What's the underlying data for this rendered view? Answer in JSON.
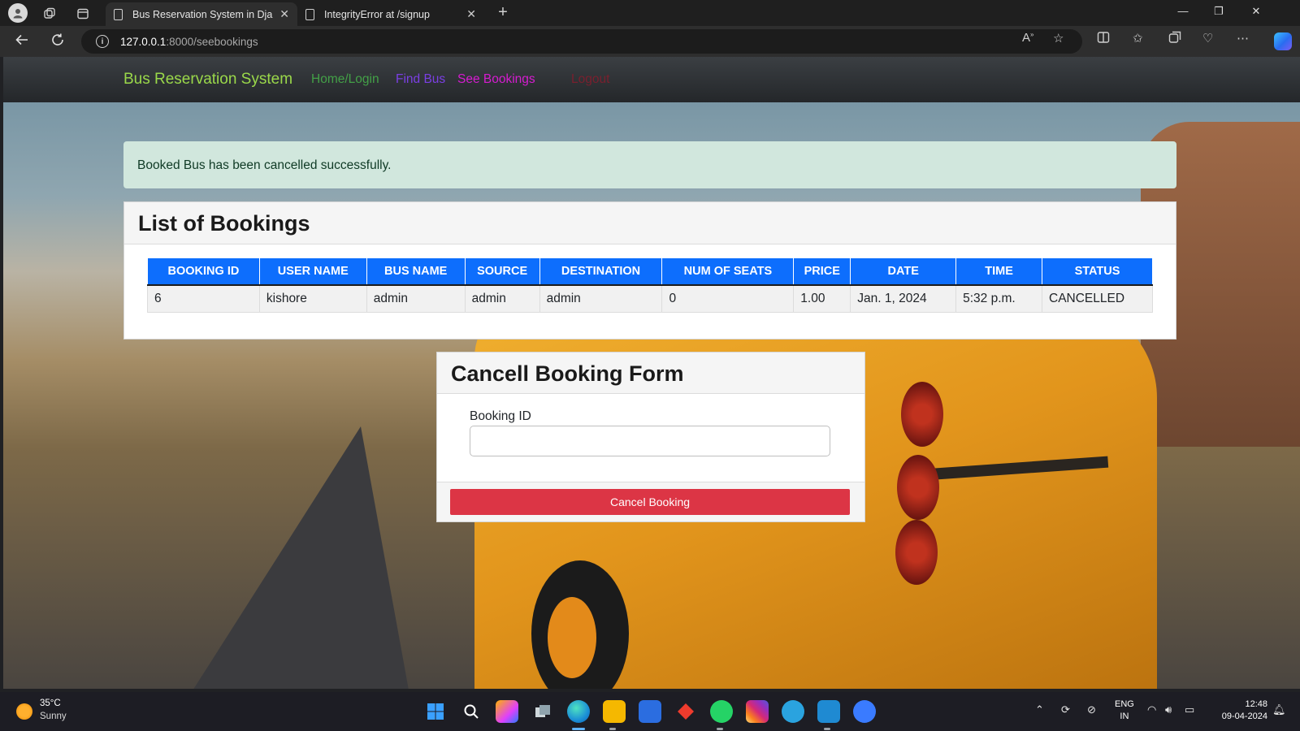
{
  "browser": {
    "tabs": [
      {
        "title": "Bus Reservation System in Djang",
        "active": true
      },
      {
        "title": "IntegrityError at /signup",
        "active": false
      }
    ],
    "url_host": "127.0.0.1",
    "url_path": ":8000/seebookings",
    "new_tab": "+",
    "close_glyph": "✕"
  },
  "navbar": {
    "brand": "Bus Reservation System",
    "links": [
      {
        "label": "Home/Login",
        "color": "#43a047"
      },
      {
        "label": "Find Bus",
        "color": "#7b3fe4"
      },
      {
        "label": "See Bookings",
        "color": "#d61cd1"
      },
      {
        "label": "Logout",
        "color": "#7a1f2e"
      }
    ]
  },
  "alert": {
    "message": "Booked Bus has been cancelled successfully."
  },
  "bookings": {
    "title": "List of Bookings",
    "columns": [
      "BOOKING ID",
      "USER NAME",
      "BUS NAME",
      "SOURCE",
      "DESTINATION",
      "NUM OF SEATS",
      "PRICE",
      "DATE",
      "TIME",
      "STATUS"
    ],
    "rows": [
      [
        "6",
        "kishore",
        "admin",
        "admin",
        "admin",
        "0",
        "1.00",
        "Jan. 1, 2024",
        "5:32 p.m.",
        "CANCELLED"
      ]
    ]
  },
  "cancel_form": {
    "title": "Cancell Booking Form",
    "field_label": "Booking ID",
    "field_value": "",
    "button_label": "Cancel Booking"
  },
  "taskbar": {
    "weather_temp": "35°C",
    "weather_condition": "Sunny",
    "lang_line1": "ENG",
    "lang_line2": "IN",
    "time": "12:48",
    "date": "09-04-2024"
  },
  "colors": {
    "table_header": "#0d6efd",
    "cancel_button": "#dc3545",
    "alert_bg": "#d1e7dd",
    "brand": "#9ad84a"
  }
}
